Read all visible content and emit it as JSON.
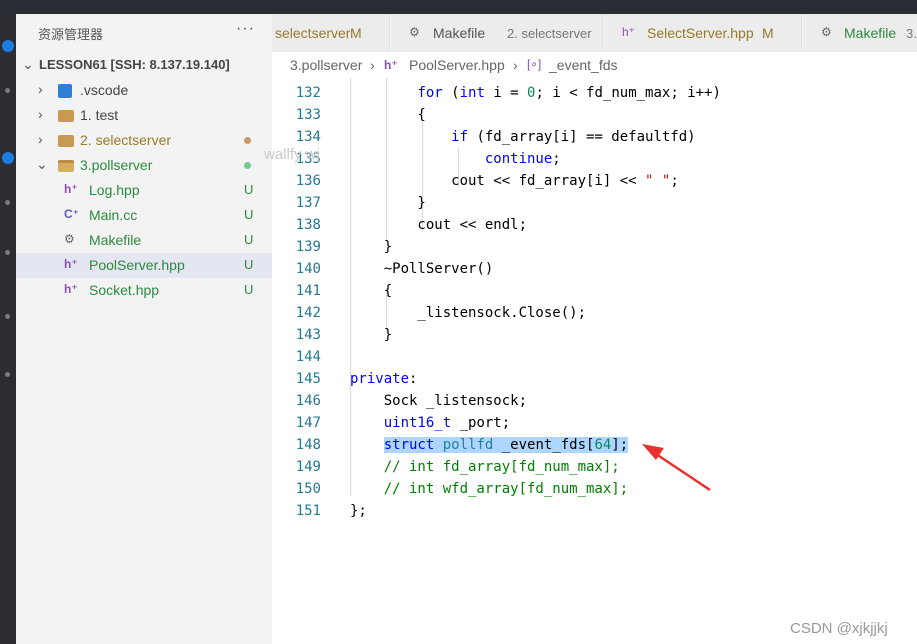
{
  "explorer": {
    "title": "资源管理器",
    "more": "···",
    "root": "LESSON61 [SSH: 8.137.19.140]",
    "items": [
      {
        "label": ".vscode",
        "status": ""
      },
      {
        "label": "1. test",
        "status": ""
      },
      {
        "label": "2. selectserver",
        "status": ""
      },
      {
        "label": "3.pollserver",
        "status": ""
      },
      {
        "label": "Log.hpp",
        "status": "U"
      },
      {
        "label": "Main.cc",
        "status": "U"
      },
      {
        "label": "Makefile",
        "status": "U"
      },
      {
        "label": "PoolServer.hpp",
        "status": "U"
      },
      {
        "label": "Socket.hpp",
        "status": "U"
      }
    ],
    "colors": {
      "modified_dot": "#c79a68",
      "untracked_dot": "#73c991"
    }
  },
  "tabs": [
    {
      "name": "selectserver",
      "desc": "",
      "mod": "M"
    },
    {
      "name": "Makefile",
      "desc": "2. selectserver",
      "mod": ""
    },
    {
      "name": "SelectServer.hpp",
      "desc": "",
      "mod": "M"
    },
    {
      "name": "Makefile",
      "desc": "3.",
      "mod": ""
    }
  ],
  "breadcrumb": {
    "folder": "3.pollserver",
    "file": "PoolServer.hpp",
    "symbol": "_event_fds"
  },
  "editor": {
    "lines": [
      {
        "n": "132",
        "t": "        for (int i = 0; i < fd_num_max; i++)"
      },
      {
        "n": "133",
        "t": "        {"
      },
      {
        "n": "134",
        "t": "            if (fd_array[i] == defaultfd)"
      },
      {
        "n": "135",
        "t": "                continue;"
      },
      {
        "n": "136",
        "t": "            cout << fd_array[i] << \" \";"
      },
      {
        "n": "137",
        "t": "        }"
      },
      {
        "n": "138",
        "t": "        cout << endl;"
      },
      {
        "n": "139",
        "t": "    }"
      },
      {
        "n": "140",
        "t": "    ~PollServer()"
      },
      {
        "n": "141",
        "t": "    {"
      },
      {
        "n": "142",
        "t": "        _listensock.Close();"
      },
      {
        "n": "143",
        "t": "    }"
      },
      {
        "n": "144",
        "t": ""
      },
      {
        "n": "145",
        "t": "private:"
      },
      {
        "n": "146",
        "t": "    Sock _listensock;"
      },
      {
        "n": "147",
        "t": "    uint16_t _port;"
      },
      {
        "n": "148",
        "t": "    struct pollfd _event_fds[64];"
      },
      {
        "n": "149",
        "t": "    // int fd_array[fd_num_max];"
      },
      {
        "n": "150",
        "t": "    // int wfd_array[fd_num_max];"
      },
      {
        "n": "151",
        "t": "};"
      }
    ],
    "selection_color": "#add6ff",
    "annotation_arrow_color": "#e8312f"
  },
  "watermarks": {
    "user": "wallfy wj",
    "csdn": "CSDN @xjkjjkj"
  }
}
